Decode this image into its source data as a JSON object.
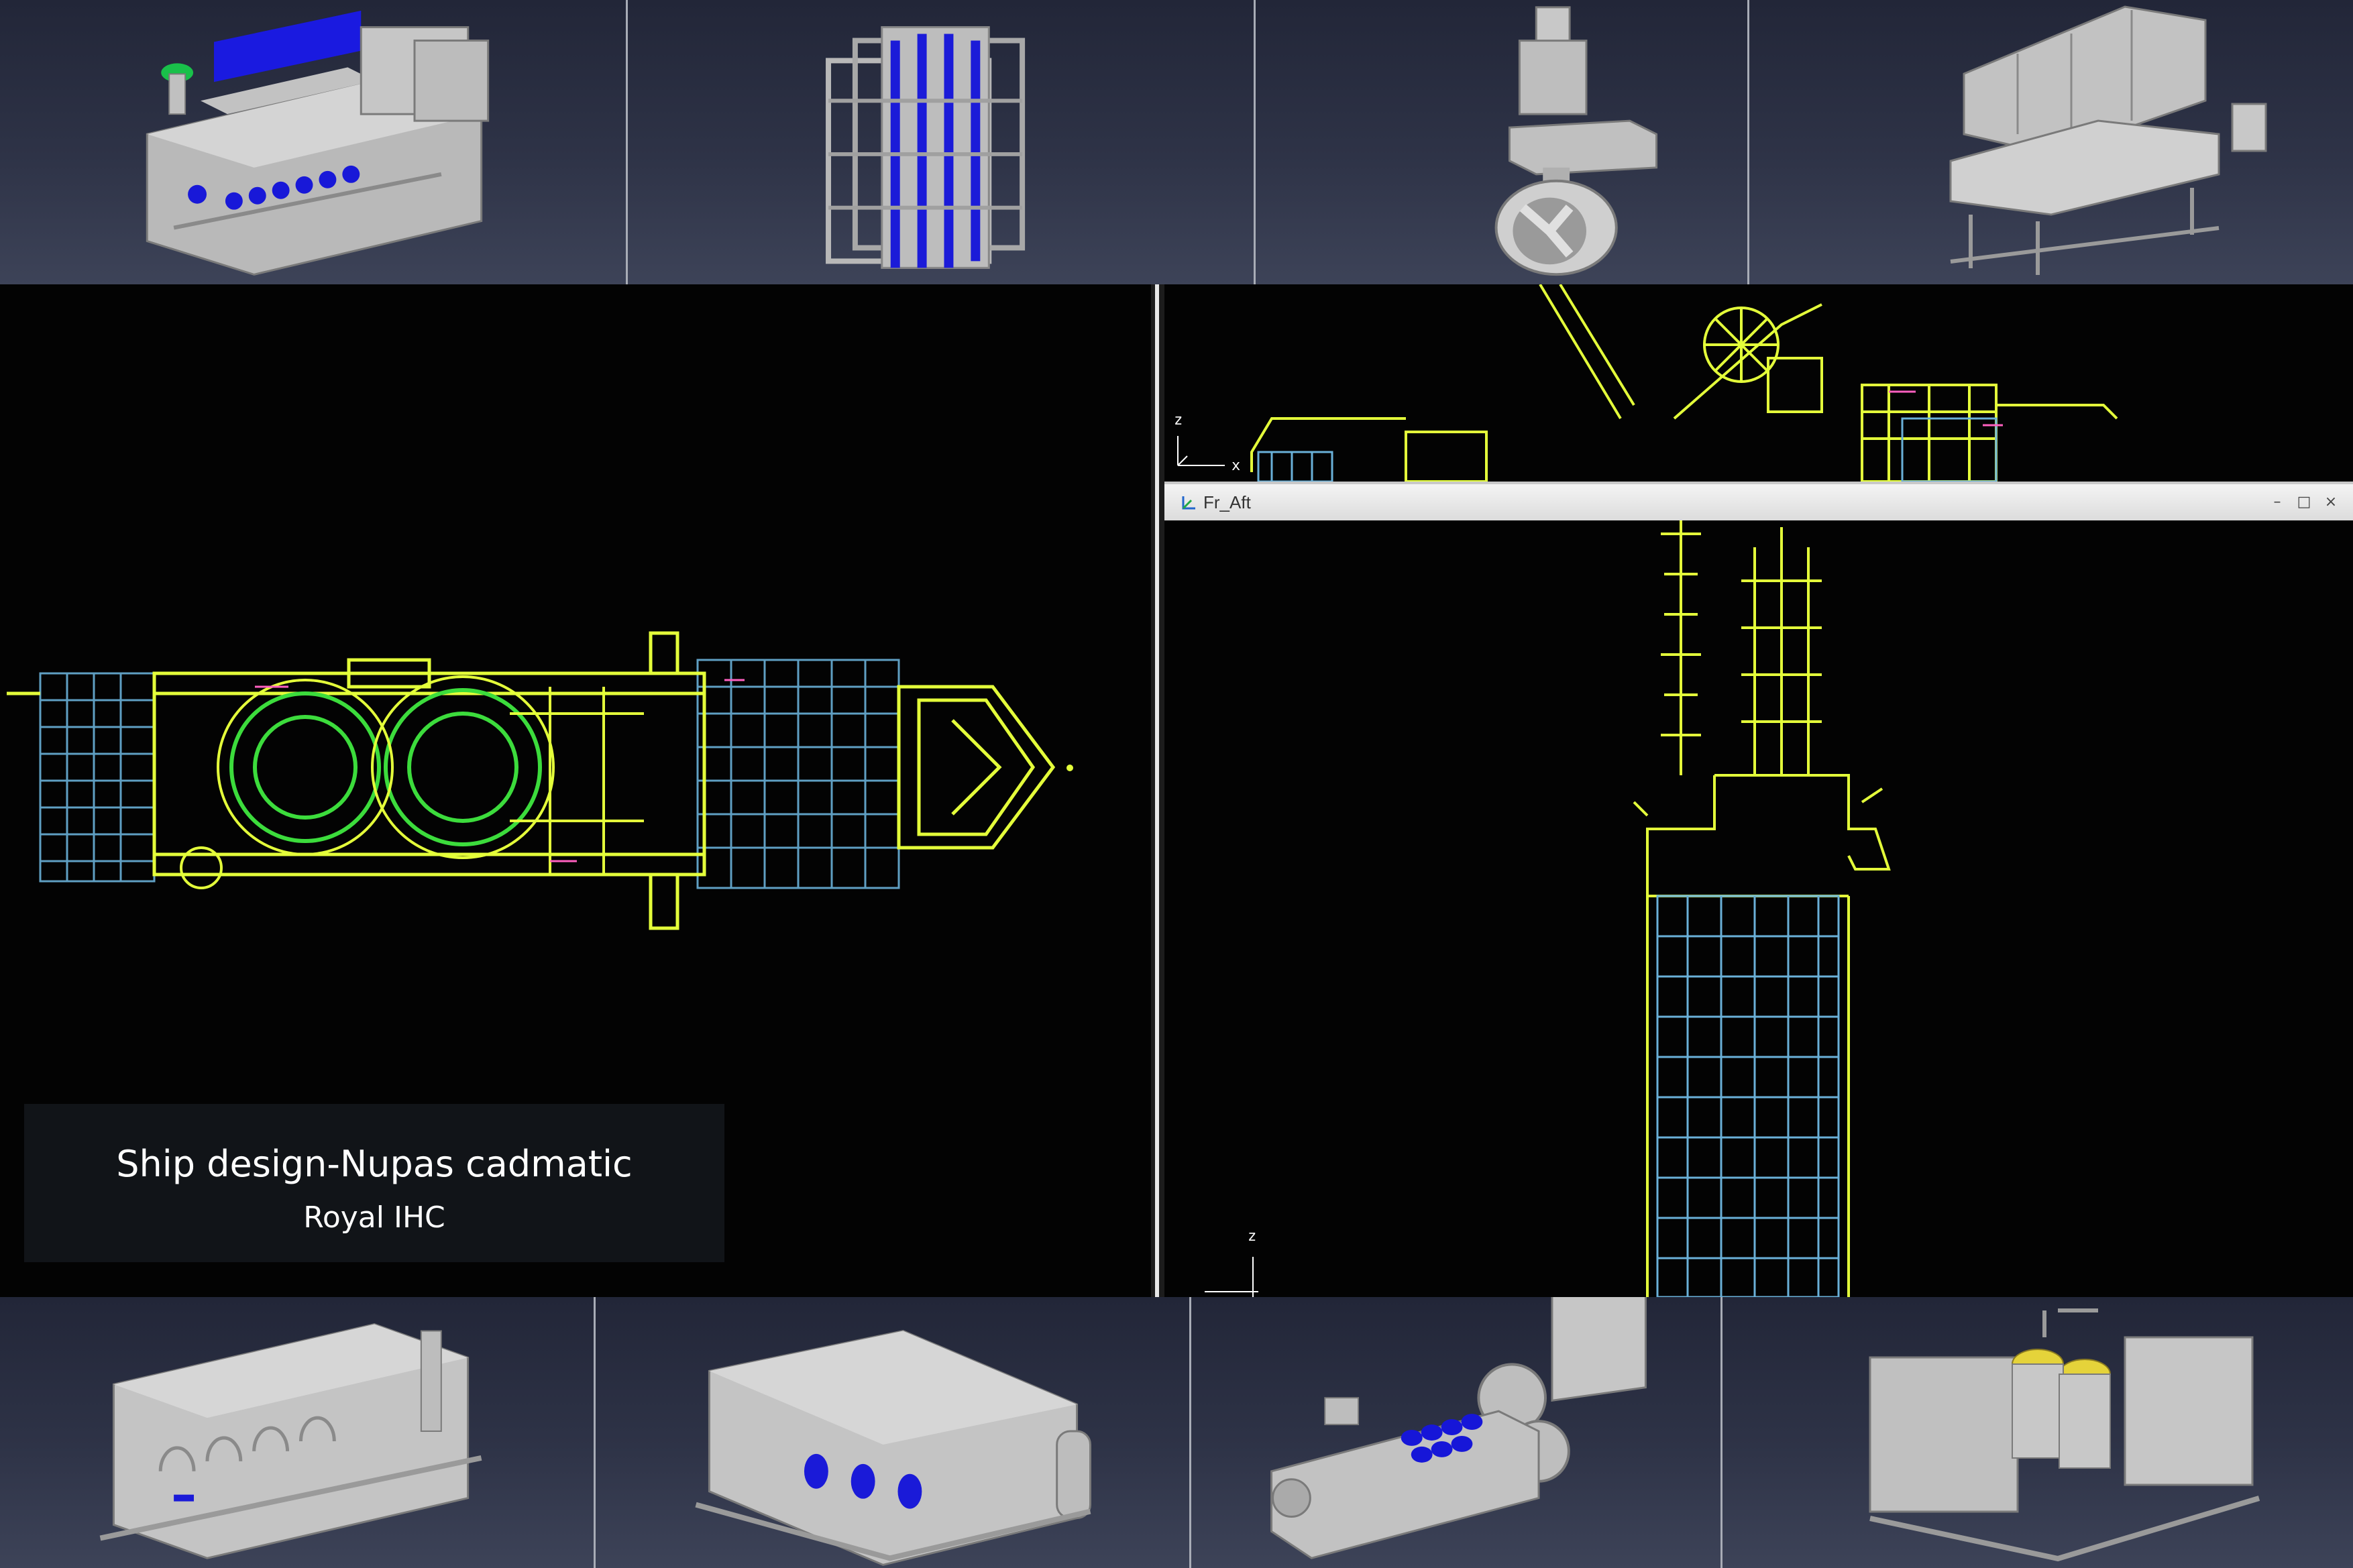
{
  "caption": {
    "title": "Ship design-Nupas cadmatic",
    "subtitle": "Royal IHC"
  },
  "viewport_side_view": {
    "axis_z": "z",
    "axis_x": "x"
  },
  "viewport_aft_view": {
    "window_title": "Fr_Aft",
    "axis_z": "z",
    "minimize": "–",
    "maximize": "□",
    "close": "×"
  },
  "colors": {
    "model_gray": "#c8c8c8",
    "model_blue": "#1414d8",
    "wire_yellow": "#e4ff3a",
    "wire_blue": "#6ab0d8",
    "wire_green": "#3cdc3c",
    "thumb_bg": "#2e3347"
  },
  "thumbnails_top": [
    "engine-icon",
    "heat-exchanger-icon",
    "azimuth-thruster-icon",
    "control-console-icon"
  ],
  "thumbnails_bottom": [
    "water-treatment-unit-icon",
    "filter-skid-icon",
    "generator-set-icon",
    "pump-skid-icon"
  ]
}
